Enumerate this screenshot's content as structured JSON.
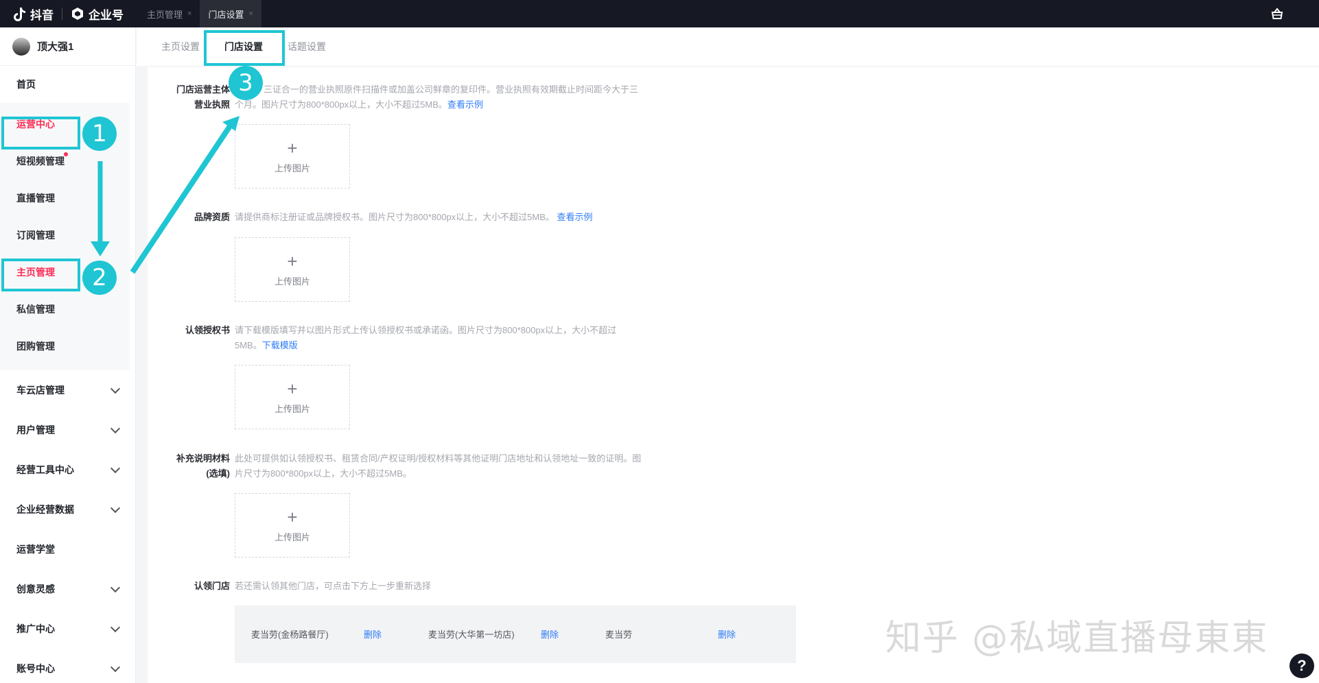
{
  "topbar": {
    "app_name": "抖音",
    "product_name": "企业号",
    "tabs": [
      {
        "label": "主页管理",
        "close": "×"
      },
      {
        "label": "门店设置",
        "close": "×"
      }
    ]
  },
  "sidebar": {
    "account_name": "顶大强1",
    "home": "首页",
    "operation_items": [
      "运营中心",
      "短视频管理",
      "直播管理",
      "订阅管理",
      "主页管理",
      "私信管理",
      "团购管理"
    ],
    "groups": [
      "车云店管理",
      "用户管理",
      "经营工具中心",
      "企业经营数据",
      "运营学堂",
      "创意灵感",
      "推广中心",
      "账号中心"
    ]
  },
  "subnav": {
    "tabs": [
      "主页设置",
      "门店设置",
      "话题设置"
    ]
  },
  "form": {
    "license_label_line1": "门店运营主体",
    "license_label_line2": "营业执照",
    "license_desc_line1": "三证合一的营业执照原件扫描件或加盖公司鲜章的复印件。营业执照有效期截止时间距今大于三",
    "license_desc_line2": "个月。图片尺寸为800*800px以上，大小不超过5MB。",
    "license_link": "查看示例",
    "brand_label": "品牌资质",
    "brand_desc": "请提供商标注册证或品牌授权书。图片尺寸为800*800px以上，大小不超过5MB。",
    "brand_link": "查看示例",
    "claim_label": "认领授权书",
    "claim_desc_line1": "请下载模版填写并以图片形式上传认领授权书或承诺函。图片尺寸为800*800px以上，大小不超过",
    "claim_desc_line2": "5MB。",
    "claim_link": "下载模版",
    "extra_label_line1": "补充说明材料",
    "extra_label_line2": "(选填)",
    "extra_desc_line1": "此处可提供如认领授权书、租赁合同/产权证明/授权材料等其他证明门店地址和认领地址一致的证明。图",
    "extra_desc_line2": "片尺寸为800*800px以上，大小不超过5MB。",
    "upload_plus": "+",
    "upload_text": "上传图片",
    "stores_label": "认领门店",
    "stores_desc": "若还需认领其他门店，可点击下方上一步重新选择",
    "stores": [
      {
        "name": "麦当劳(金杨路餐厅)",
        "action": "删除"
      },
      {
        "name": "麦当劳(大华第一坊店)",
        "action": "删除"
      },
      {
        "name": "麦当劳",
        "action": "删除"
      }
    ]
  },
  "annotations": {
    "steps": [
      "1",
      "2",
      "3"
    ],
    "color": "#1fc5d3"
  },
  "watermark": "知乎 @私域直播母東東",
  "help": "?",
  "colors": {
    "topbar_bg": "#161823",
    "active_red": "#fe2c55",
    "link_blue": "#2e7cf6"
  }
}
